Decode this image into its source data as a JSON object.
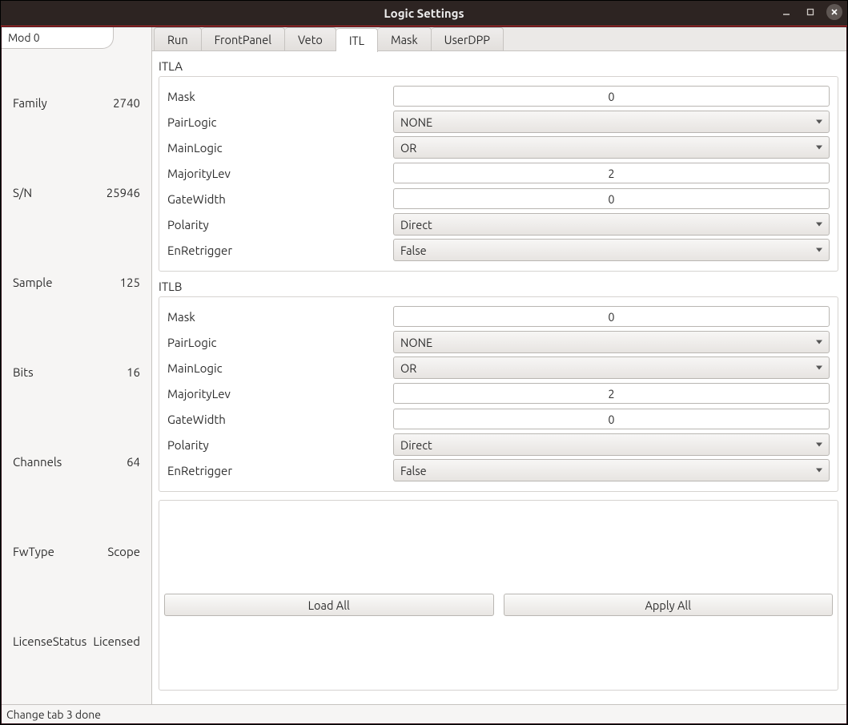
{
  "window": {
    "title": "Logic Settings"
  },
  "sidebar": {
    "tab_label": "Mod 0",
    "info": [
      {
        "k": "Family",
        "v": "2740"
      },
      {
        "k": "S/N",
        "v": "25946"
      },
      {
        "k": "Sample",
        "v": "125"
      },
      {
        "k": "Bits",
        "v": "16"
      },
      {
        "k": "Channels",
        "v": "64"
      },
      {
        "k": "FwType",
        "v": "Scope"
      },
      {
        "k": "LicenseStatus",
        "v": "Licensed"
      }
    ]
  },
  "tabs": [
    {
      "label": "Run"
    },
    {
      "label": "FrontPanel"
    },
    {
      "label": "Veto"
    },
    {
      "label": "ITL",
      "active": true
    },
    {
      "label": "Mask"
    },
    {
      "label": "UserDPP"
    }
  ],
  "itla": {
    "title": "ITLA",
    "mask_label": "Mask",
    "mask_value": "0",
    "pairlogic_label": "PairLogic",
    "pairlogic_value": "NONE",
    "mainlogic_label": "MainLogic",
    "mainlogic_value": "OR",
    "majoritylev_label": "MajorityLev",
    "majoritylev_value": "2",
    "gatewidth_label": "GateWidth",
    "gatewidth_value": "0",
    "polarity_label": "Polarity",
    "polarity_value": "Direct",
    "enretrigger_label": "EnRetrigger",
    "enretrigger_value": "False"
  },
  "itlb": {
    "title": "ITLB",
    "mask_label": "Mask",
    "mask_value": "0",
    "pairlogic_label": "PairLogic",
    "pairlogic_value": "NONE",
    "mainlogic_label": "MainLogic",
    "mainlogic_value": "OR",
    "majoritylev_label": "MajorityLev",
    "majoritylev_value": "2",
    "gatewidth_label": "GateWidth",
    "gatewidth_value": "0",
    "polarity_label": "Polarity",
    "polarity_value": "Direct",
    "enretrigger_label": "EnRetrigger",
    "enretrigger_value": "False"
  },
  "buttons": {
    "load_all": "Load All",
    "apply_all": "Apply All"
  },
  "status": "Change tab 3 done"
}
